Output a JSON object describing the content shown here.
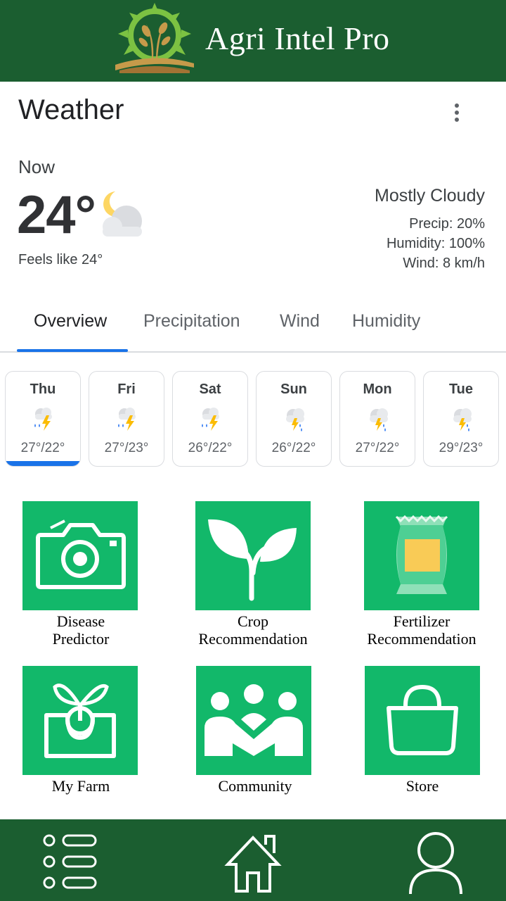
{
  "header": {
    "app_title": "Agri Intel Pro"
  },
  "weather": {
    "title": "Weather",
    "now_label": "Now",
    "temperature": "24°",
    "feels_like": "Feels like 24°",
    "condition": "Mostly Cloudy",
    "precip": "Precip: 20%",
    "humidity": "Humidity: 100%",
    "wind": "Wind: 8 km/h",
    "icon": "moon-cloud-icon"
  },
  "tabs": [
    {
      "label": "Overview",
      "selected": true
    },
    {
      "label": "Precipitation",
      "selected": false
    },
    {
      "label": "Wind",
      "selected": false
    },
    {
      "label": "Humidity",
      "selected": false
    }
  ],
  "forecast": [
    {
      "day": "Thu",
      "temps": "27°/22°",
      "icon": "thunderstorm-rain-icon",
      "selected": true
    },
    {
      "day": "Fri",
      "temps": "27°/23°",
      "icon": "thunderstorm-rain-icon",
      "selected": false
    },
    {
      "day": "Sat",
      "temps": "26°/22°",
      "icon": "thunderstorm-rain-icon",
      "selected": false
    },
    {
      "day": "Sun",
      "temps": "26°/22°",
      "icon": "cloud-storm-icon",
      "selected": false
    },
    {
      "day": "Mon",
      "temps": "27°/22°",
      "icon": "cloud-storm-icon",
      "selected": false
    },
    {
      "day": "Tue",
      "temps": "29°/23°",
      "icon": "cloud-storm-icon",
      "selected": false
    }
  ],
  "features": [
    {
      "label": "Disease\nPredictor",
      "icon": "camera-icon"
    },
    {
      "label": "Crop\nRecommendation",
      "icon": "plant-icon"
    },
    {
      "label": "Fertilizer\nRecommendation",
      "icon": "fertilizer-bag-icon"
    },
    {
      "label": "My Farm",
      "icon": "seedling-pot-icon"
    },
    {
      "label": "Community",
      "icon": "community-icon"
    },
    {
      "label": "Store",
      "icon": "shopping-bag-icon"
    }
  ],
  "bottom_nav": [
    {
      "name": "menu",
      "icon": "list-menu-icon"
    },
    {
      "name": "home",
      "icon": "home-icon"
    },
    {
      "name": "profile",
      "icon": "user-icon"
    }
  ],
  "colors": {
    "header_bg": "#1b5e30",
    "tile_bg": "#12b86a",
    "accent": "#1a73e8"
  }
}
